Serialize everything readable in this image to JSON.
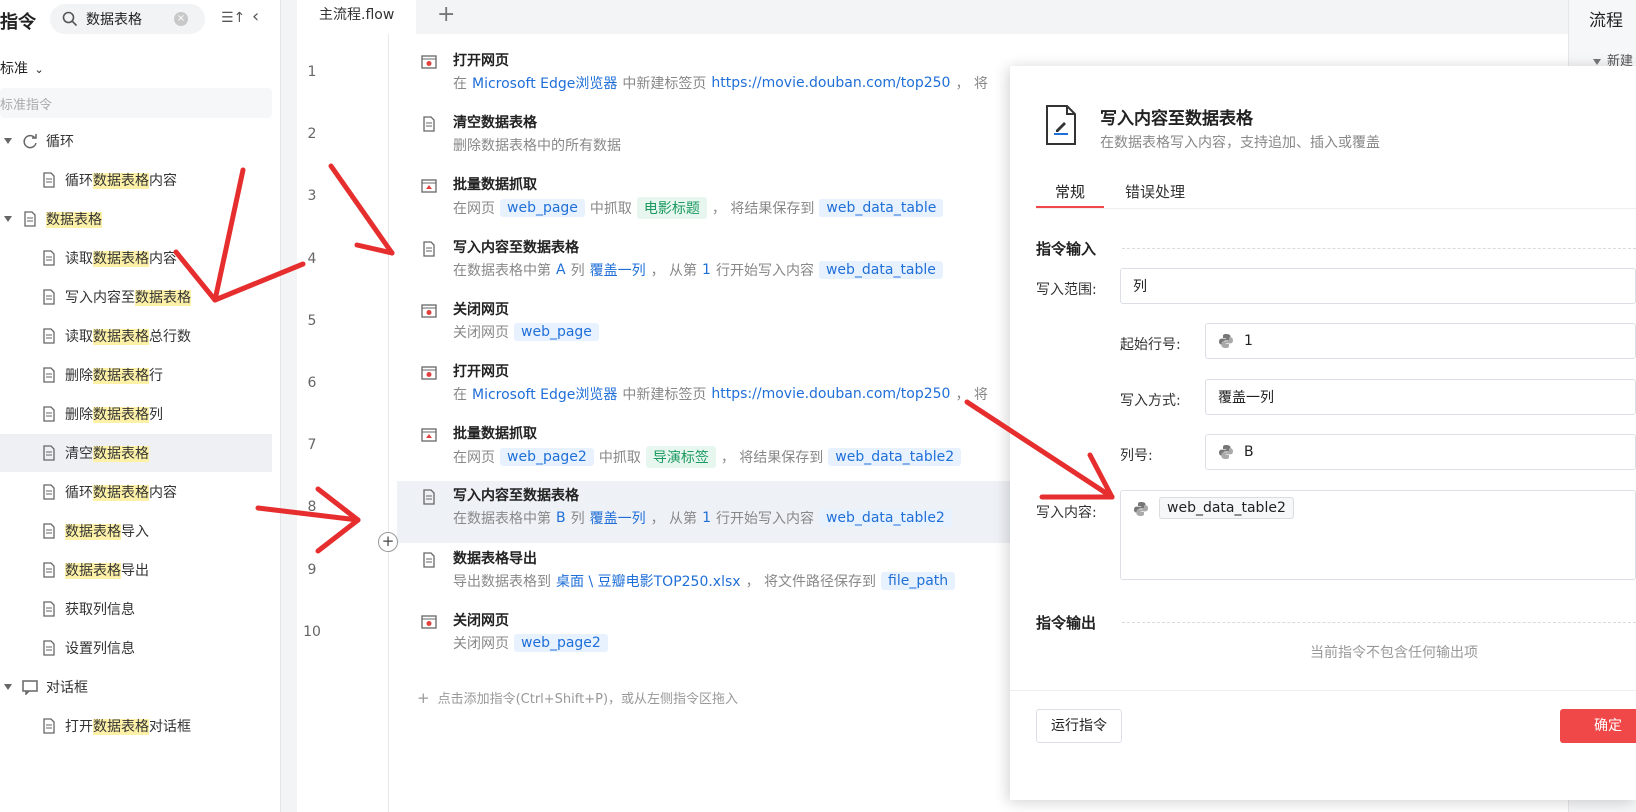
{
  "left": {
    "title": "指令",
    "search_value": "数据表格",
    "category": "标准",
    "search_std_placeholder": "标准指令",
    "groups": [
      {
        "label": "循环",
        "icon": "loop-icon",
        "children": [
          {
            "pre": "循环",
            "hl": "数据表格",
            "post": "内容",
            "icon": "loop-table-icon"
          }
        ]
      },
      {
        "label": "数据表格",
        "icon": "table-doc-icon",
        "children": [
          {
            "pre": "读取",
            "hl": "数据表格",
            "post": "内容",
            "icon": "read-table-icon"
          },
          {
            "pre": "写入内容至",
            "hl": "数据表格",
            "post": "",
            "icon": "write-table-icon"
          },
          {
            "pre": "读取",
            "hl": "数据表格",
            "post": "总行数",
            "icon": "doc-icon"
          },
          {
            "pre": "删除",
            "hl": "数据表格",
            "post": "行",
            "icon": "doc-icon"
          },
          {
            "pre": "删除",
            "hl": "数据表格",
            "post": "列",
            "icon": "chart-doc-icon"
          },
          {
            "pre": "清空",
            "hl": "数据表格",
            "post": "",
            "icon": "clear-table-icon"
          },
          {
            "pre": "循环",
            "hl": "数据表格",
            "post": "内容",
            "icon": "loop-table-icon"
          },
          {
            "pre": "",
            "hl": "数据表格",
            "post": "导入",
            "icon": "import-icon"
          },
          {
            "pre": "",
            "hl": "数据表格",
            "post": "导出",
            "icon": "export-icon"
          },
          {
            "pre": "获取列信息",
            "hl": "",
            "post": "",
            "icon": "doc-icon"
          },
          {
            "pre": "设置列信息",
            "hl": "",
            "post": "",
            "icon": "set-column-icon"
          }
        ]
      },
      {
        "label": "对话框",
        "icon": "dialog-icon",
        "children": [
          {
            "pre": "打开",
            "hl": "数据表格",
            "post": "对话框",
            "icon": "dialog-table-icon"
          }
        ]
      }
    ]
  },
  "editor": {
    "tab": "主流程.flow",
    "add_tab": "+",
    "steps": [
      {
        "n": "1",
        "title": "打开网页",
        "icon": "browser-icon",
        "parts": [
          {
            "t": "在",
            "c": ""
          },
          {
            "t": "Microsoft Edge浏览器",
            "c": "blue"
          },
          {
            "t": "中新建标签页",
            "c": ""
          },
          {
            "t": "https://movie.douban.com/top250",
            "c": "blue"
          },
          {
            "t": "， 将",
            "c": ""
          }
        ]
      },
      {
        "n": "2",
        "title": "清空数据表格",
        "icon": "clear-table-icon",
        "parts": [
          {
            "t": "删除数据表格中的所有数据",
            "c": ""
          }
        ]
      },
      {
        "n": "3",
        "title": "批量数据抓取",
        "icon": "scrape-icon",
        "parts": [
          {
            "t": "在网页",
            "c": ""
          },
          {
            "t": "web_page",
            "c": "tag"
          },
          {
            "t": "中抓取",
            "c": ""
          },
          {
            "t": "电影标题",
            "c": "tagg"
          },
          {
            "t": "， 将结果保存到",
            "c": ""
          },
          {
            "t": "web_data_table",
            "c": "tag"
          }
        ]
      },
      {
        "n": "4",
        "title": "写入内容至数据表格",
        "icon": "write-table-icon",
        "parts": [
          {
            "t": "在数据表格中第",
            "c": ""
          },
          {
            "t": "A",
            "c": "blue"
          },
          {
            "t": "列",
            "c": ""
          },
          {
            "t": "覆盖一列",
            "c": "blue"
          },
          {
            "t": "， 从第",
            "c": ""
          },
          {
            "t": "1",
            "c": "blue"
          },
          {
            "t": "行开始写入内容",
            "c": ""
          },
          {
            "t": "web_data_table",
            "c": "tag"
          }
        ]
      },
      {
        "n": "5",
        "title": "关闭网页",
        "icon": "close-page-icon",
        "parts": [
          {
            "t": "关闭网页",
            "c": ""
          },
          {
            "t": "web_page",
            "c": "tag"
          }
        ]
      },
      {
        "n": "6",
        "title": "打开网页",
        "icon": "browser-icon",
        "parts": [
          {
            "t": "在",
            "c": ""
          },
          {
            "t": "Microsoft Edge浏览器",
            "c": "blue"
          },
          {
            "t": "中新建标签页",
            "c": ""
          },
          {
            "t": "https://movie.douban.com/top250",
            "c": "blue"
          },
          {
            "t": "， 将",
            "c": ""
          }
        ]
      },
      {
        "n": "7",
        "title": "批量数据抓取",
        "icon": "scrape-icon",
        "parts": [
          {
            "t": "在网页",
            "c": ""
          },
          {
            "t": "web_page2",
            "c": "tag"
          },
          {
            "t": "中抓取",
            "c": ""
          },
          {
            "t": "导演标签",
            "c": "tagg"
          },
          {
            "t": "， 将结果保存到",
            "c": ""
          },
          {
            "t": "web_data_table2",
            "c": "tag"
          }
        ]
      },
      {
        "n": "8",
        "title": "写入内容至数据表格",
        "icon": "write-table-icon",
        "parts": [
          {
            "t": "在数据表格中第",
            "c": ""
          },
          {
            "t": "B",
            "c": "blue"
          },
          {
            "t": "列",
            "c": ""
          },
          {
            "t": "覆盖一列",
            "c": "blue"
          },
          {
            "t": "， 从第",
            "c": ""
          },
          {
            "t": "1",
            "c": "blue"
          },
          {
            "t": "行开始写入内容",
            "c": ""
          },
          {
            "t": "web_data_table2",
            "c": "tag"
          }
        ]
      },
      {
        "n": "9",
        "title": "数据表格导出",
        "icon": "export-icon",
        "parts": [
          {
            "t": "导出数据表格到",
            "c": ""
          },
          {
            "t": "桌面 \\ 豆瓣电影TOP250.xlsx",
            "c": "blue"
          },
          {
            "t": "， 将文件路径保存到",
            "c": ""
          },
          {
            "t": "file_path",
            "c": "tag"
          }
        ]
      },
      {
        "n": "10",
        "title": "关闭网页",
        "icon": "close-page-icon",
        "parts": [
          {
            "t": "关闭网页",
            "c": ""
          },
          {
            "t": "web_page2",
            "c": "tag"
          }
        ]
      }
    ],
    "add_hint": "点击添加指令(Ctrl+Shift+P)，或从左侧指令区拖入"
  },
  "dialog": {
    "title": "写入内容至数据表格",
    "subtitle": "在数据表格写入内容，支持追加、插入或覆盖",
    "tabs": [
      "常规",
      "错误处理"
    ],
    "input_section": "指令输入",
    "fields": {
      "range_label": "写入范围:",
      "range_value": "列",
      "start_label": "起始行号:",
      "start_value": "1",
      "mode_label": "写入方式:",
      "mode_value": "覆盖一列",
      "col_label": "列号:",
      "col_value": "B",
      "content_label": "写入内容:",
      "content_value": "web_data_table2"
    },
    "output_section": "指令输出",
    "output_empty": "当前指令不包含任何输出项",
    "run_button": "运行指令",
    "confirm_button": "确定"
  },
  "right_panel": {
    "title": "流程",
    "item": "新建"
  },
  "colors": {
    "accent": "#1f6fd8",
    "danger": "#f04848",
    "highlight": "#fdf1a8",
    "arrow": "#e62e2e"
  }
}
